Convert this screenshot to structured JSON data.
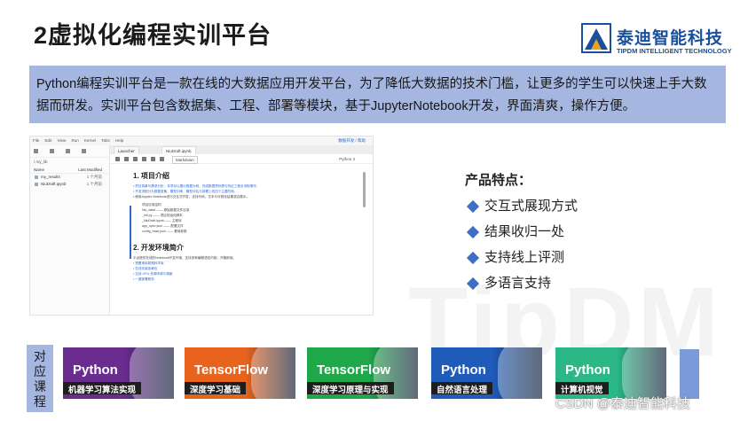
{
  "header": {
    "title": "2虚拟化编程实训平台",
    "logo_cn": "泰迪智能科技",
    "logo_en": "TIPDM INTELLIGENT TECHNOLOGY"
  },
  "intro": {
    "text": "Python编程实训平台是一款在线的大数据应用开发平台，为了降低大数据的技术门槛，让更多的学生可以快速上手大数据而研发。实训平台包含数据集、工程、部署等模块，基于JupyterNotebook开发，界面清爽，操作方便。"
  },
  "screenshot": {
    "menu": [
      "File",
      "Edit",
      "View",
      "Run",
      "Kernel",
      "Tabs",
      "Help"
    ],
    "menu_right": "数据开发 / 帮助",
    "path": "/ my_lib",
    "col_name": "Name",
    "col_modified": "Last Modified",
    "files": [
      {
        "name": "my_results",
        "modified": "1 个月前"
      },
      {
        "name": "NiuDraft.ipynb",
        "modified": "1 个月前"
      }
    ],
    "tab1": "Launcher",
    "tab2": "NiuDraft.ipynb",
    "kernel_select": "Markdown",
    "kernel_status": "Python 3",
    "h1": "1. 项目介绍",
    "h2": "2. 开发环境简介",
    "lines_a": [
      "• 项目背景与需求分析，本项目以图片数据为例，完成数据预处理与特征工程全流程操作。",
      "• 开发流程分为数据准备、模型训练、模型评估与部署上线四个主要阶段。",
      "• 使用Jupyter Notebook进行交互式开发，支持代码、文本与可视化结果混合展示。"
    ],
    "lines_b": [
      "项目目录结构",
      "Niu_data/ —— 原始数据文件目录",
      "_init.py —— 项目初始化脚本",
      "_NiuDraft.ipynb —— 主程序",
      "app_spec.json —— 配置文件",
      "config_base.json —— 基础参数"
    ],
    "lines_c": [
      "平台提供在线的Notebook开发环境，支持多种编程语言内核，开箱即用。",
      "• 预置常用数据科学库",
      "• 在线安装依赖包",
      "• 支持 GPU 资源申请与调度",
      "• 一键部署服务"
    ]
  },
  "features": {
    "title": "产品特点：",
    "items": [
      "交互式展现方式",
      "结果收归一处",
      "支持线上评测",
      "多语言支持"
    ]
  },
  "watermark": "TipDM",
  "courses": {
    "label": "对应课程",
    "cards": [
      {
        "lang": "Python",
        "title": "机器学习算法实现",
        "color": "#6a2c8f"
      },
      {
        "lang": "TensorFlow",
        "title": "深度学习基础",
        "color": "#e8641e"
      },
      {
        "lang": "TensorFlow",
        "title": "深度学习原理与实现",
        "color": "#1fa84a"
      },
      {
        "lang": "Python",
        "title": "自然语言处理",
        "color": "#1f5bb8"
      },
      {
        "lang": "Python",
        "title": "计算机视觉",
        "color": "#2bb886"
      }
    ]
  },
  "footer": {
    "csdn": "CSDN @泰迪智能科技"
  }
}
